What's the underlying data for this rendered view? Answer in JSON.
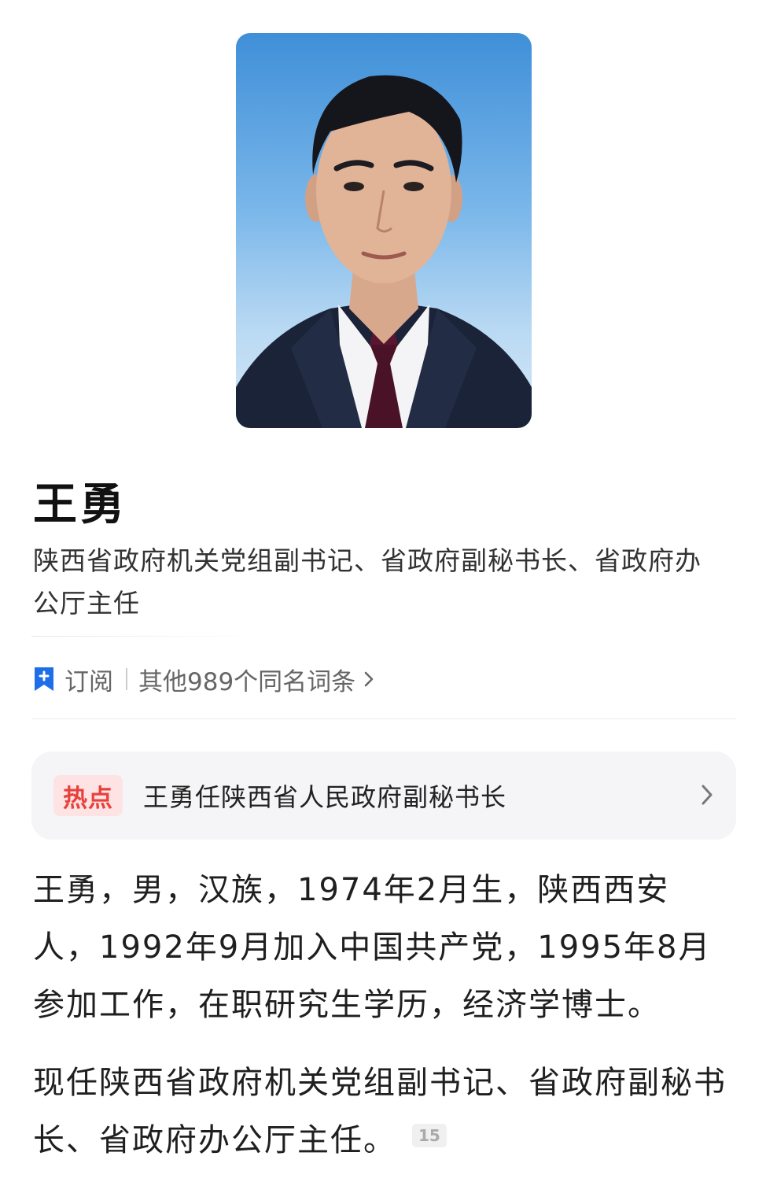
{
  "profile": {
    "name": "王勇",
    "subtitle": "陕西省政府机关党组副书记、省政府副秘书长、省政府办公厅主任"
  },
  "actions": {
    "subscribe_label": "订阅",
    "same_name_label": "其他989个同名词条"
  },
  "hot": {
    "badge": "热点",
    "text": "王勇任陕西省人民政府副秘书长"
  },
  "body": {
    "paragraph1": "王勇，男，汉族，1974年2月生，陕西西安人，1992年9月加入中国共产党，1995年8月参加工作，在职研究生学历，经济学博士。",
    "paragraph2": "现任陕西省政府机关党组副书记、省政府副秘书长、省政府办公厅主任。",
    "ref": "15"
  },
  "icons": {
    "subscribe": "bookmark-plus-icon",
    "chevron": "chevron-right-icon"
  },
  "colors": {
    "accent": "#1e6ee8",
    "hot_text": "#e8413d",
    "hot_bg": "#fde3e3"
  }
}
